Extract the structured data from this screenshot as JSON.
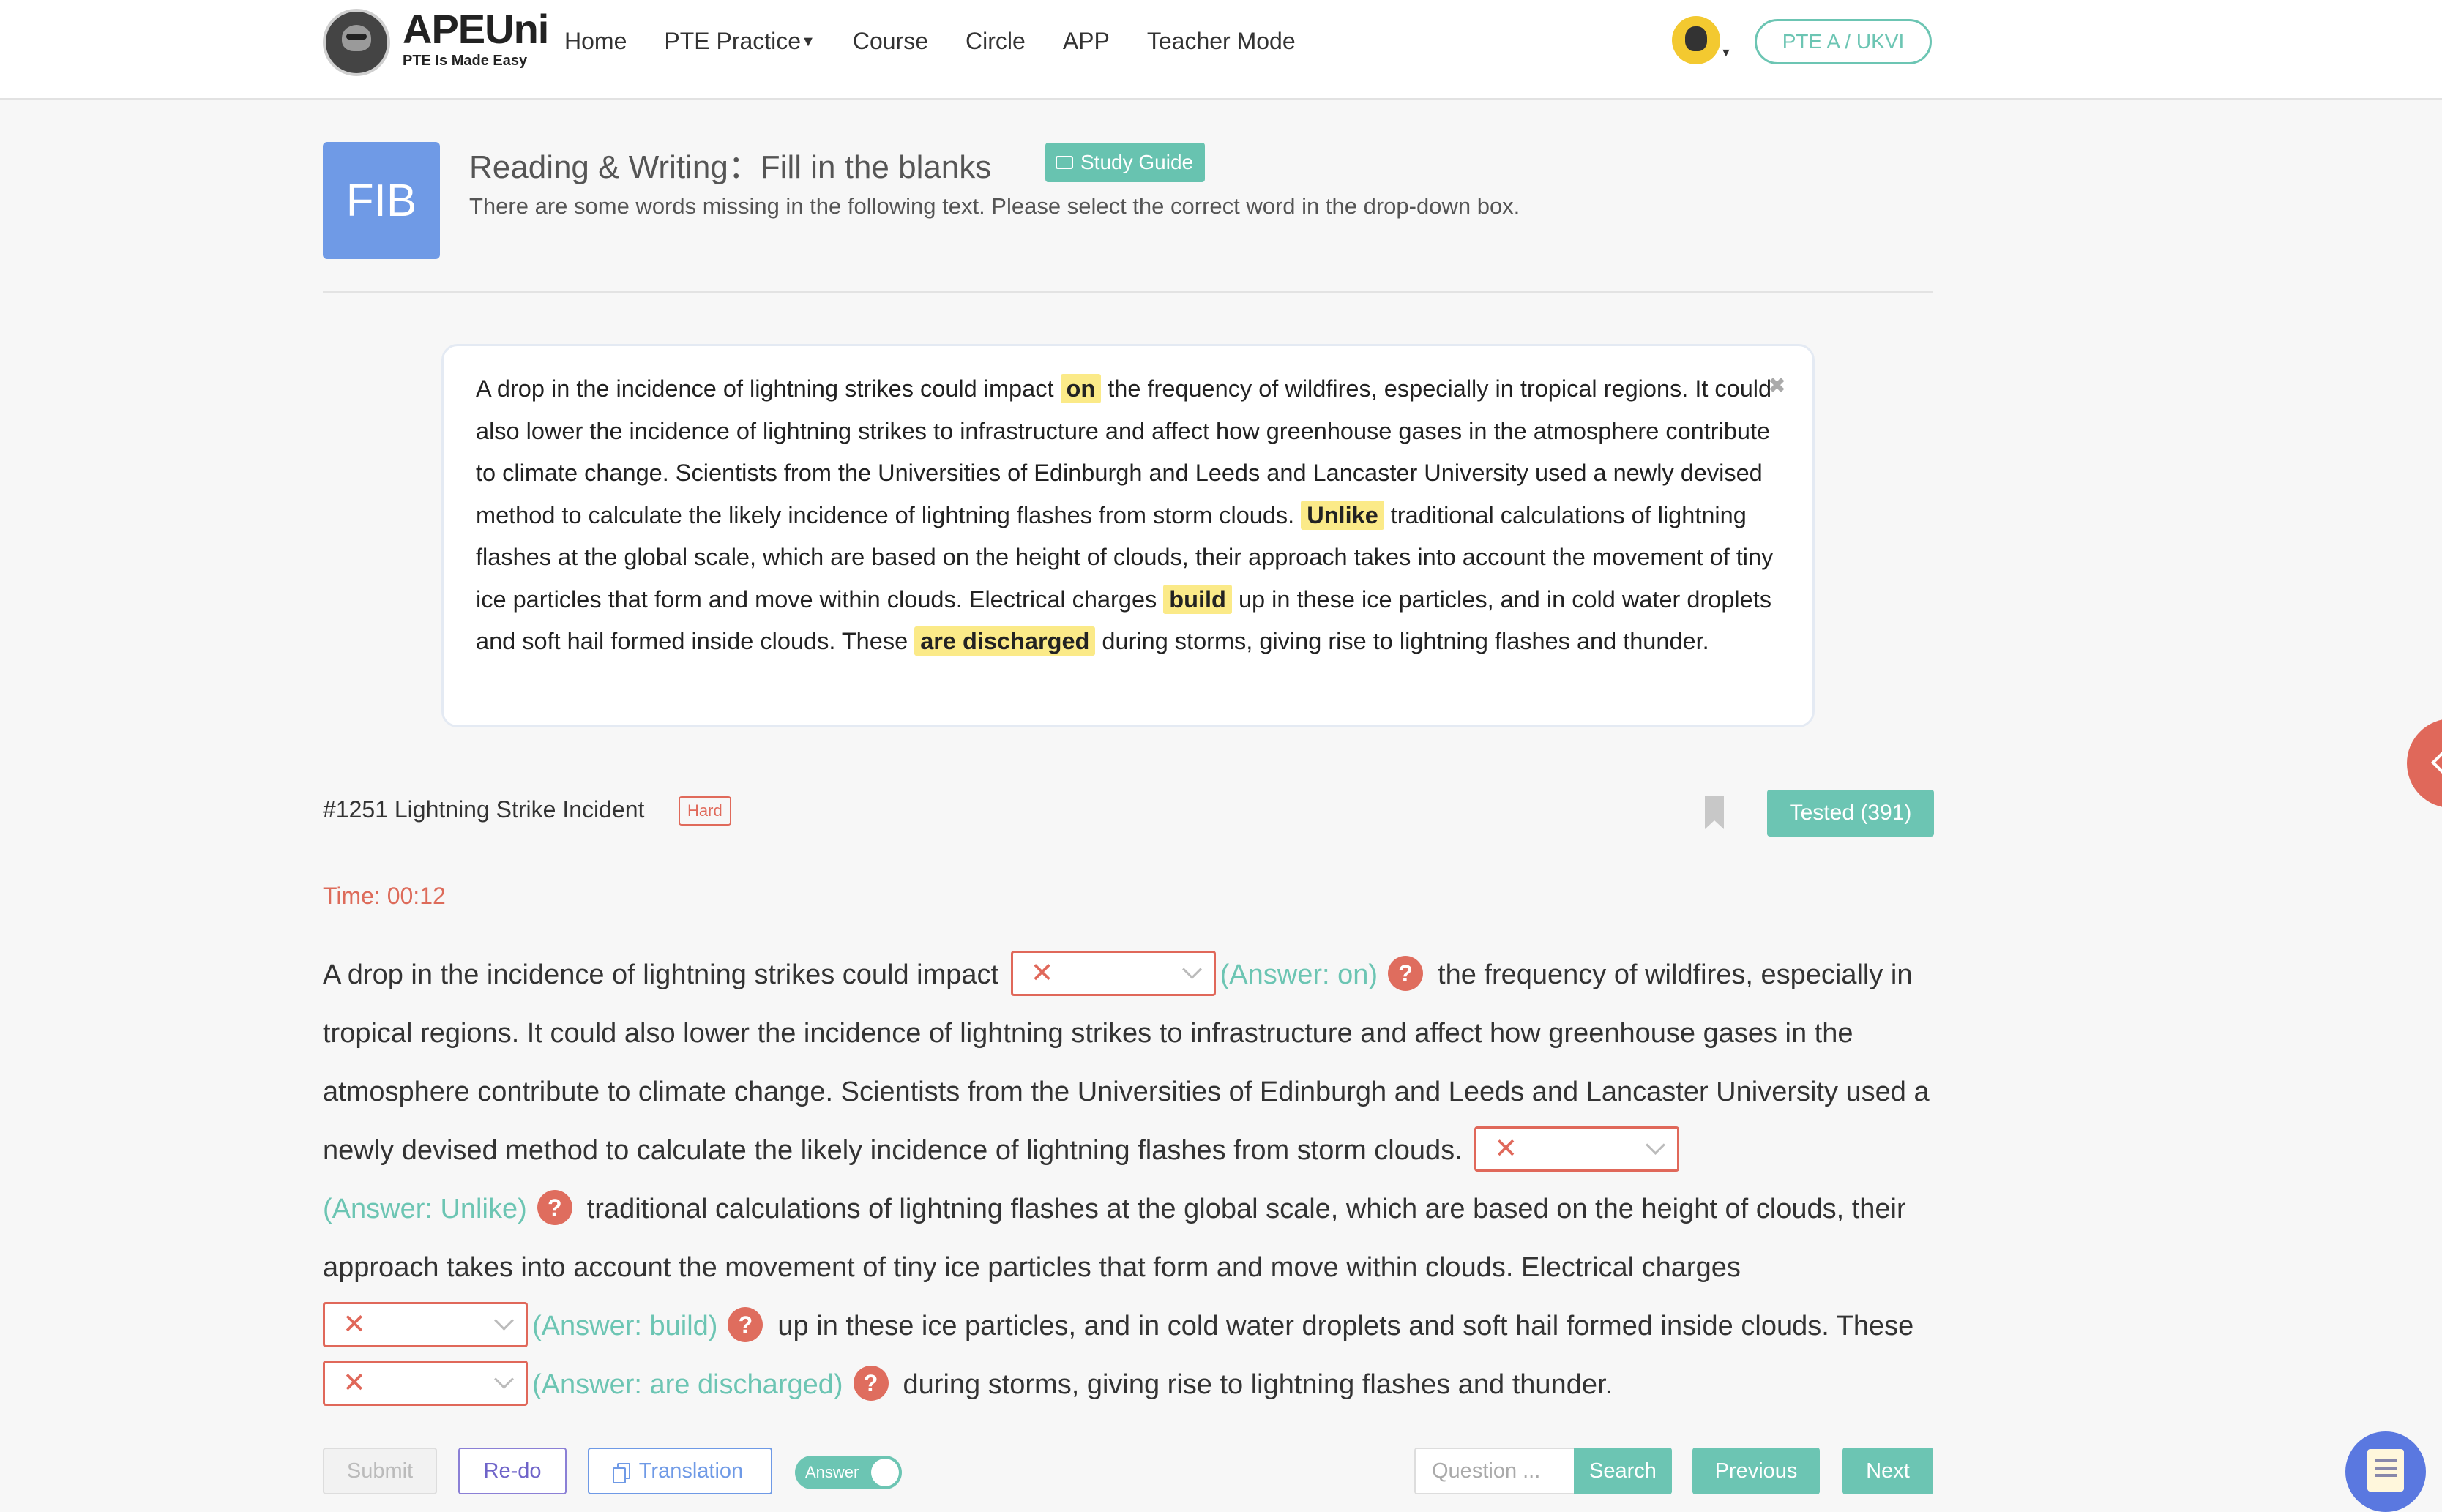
{
  "header": {
    "brand_name": "APEUni",
    "brand_tagline": "PTE Is Made Easy",
    "nav": [
      {
        "label": "Home"
      },
      {
        "label": "PTE Practice",
        "has_dropdown": true
      },
      {
        "label": "Course"
      },
      {
        "label": "Circle"
      },
      {
        "label": "APP"
      },
      {
        "label": "Teacher Mode"
      }
    ],
    "exam_type_button": "PTE A / UKVI"
  },
  "task": {
    "icon_text": "FIB",
    "title": "Reading & Writing：Fill in the blanks",
    "study_guide_label": "Study Guide",
    "description": "There are some words missing in the following text. Please select the correct word in the drop-down box."
  },
  "preview": {
    "segments": [
      {
        "text": "A drop in the incidence of lightning strikes could impact "
      },
      {
        "text": "on",
        "highlight": true
      },
      {
        "text": " the frequency of wildfires, especially in tropical regions. It could also lower the incidence of lightning strikes to infrastructure and affect how greenhouse gases in the atmosphere contribute to climate change. Scientists from the Universities of Edinburgh and Leeds and Lancaster University used a newly devised method to calculate the likely incidence of lightning flashes from storm clouds. "
      },
      {
        "text": "Unlike",
        "highlight": true
      },
      {
        "text": " traditional calculations of lightning flashes at the global scale, which are based on the height of clouds, their approach takes into account the movement of tiny ice particles that form and move within clouds. Electrical charges "
      },
      {
        "text": "build",
        "highlight": true
      },
      {
        "text": " up in these ice particles, and in cold water droplets and soft hail formed inside clouds. These "
      },
      {
        "text": "are discharged",
        "highlight": true
      },
      {
        "text": " during storms, giving rise to lightning flashes and thunder."
      }
    ]
  },
  "question": {
    "id_title": "#1251 Lightning Strike Incident",
    "difficulty": "Hard",
    "tested_label": "Tested (391)",
    "timer": "Time: 00:12"
  },
  "passage": {
    "segments": [
      {
        "text": "A drop in the incidence of lightning strikes could impact "
      },
      {
        "blank": true,
        "mark": "✕",
        "answer": "(Answer: on)"
      },
      {
        "text": "the frequency of wildfires, especially in tropical regions. It could also lower the incidence of lightning strikes to infrastructure and affect how greenhouse gases in the atmosphere contribute to climate change. Scientists from the Universities of Edinburgh and Leeds and Lancaster University used a newly devised method to calculate the likely incidence of lightning flashes from storm clouds. "
      },
      {
        "blank": true,
        "mark": "✕",
        "answer": "(Answer: Unlike)"
      },
      {
        "text": "traditional calculations of lightning flashes at the global scale, which are based on the height of clouds, their approach takes into account the movement of tiny ice particles that form and move within clouds. Electrical charges "
      },
      {
        "blank": true,
        "mark": "✕",
        "answer": "(Answer: build)"
      },
      {
        "text": "up in these ice particles, and in cold water droplets and soft hail formed inside clouds. These "
      },
      {
        "blank": true,
        "mark": "✕",
        "answer": "(Answer: are discharged)"
      },
      {
        "text": "during storms, giving rise to lightning flashes and thunder."
      }
    ]
  },
  "toolbar": {
    "submit_label": "Submit",
    "redo_label": "Re-do",
    "translation_label": "Translation",
    "answer_toggle_label": "Answer",
    "answer_toggle_on": true,
    "search_placeholder": "Question ...",
    "search_label": "Search",
    "previous_label": "Previous",
    "next_label": "Next"
  },
  "colors": {
    "accent_teal": "#6cc5b3",
    "error_red": "#e0685a",
    "fib_blue": "#6f9ae6",
    "highlight_yellow": "#fbea88"
  }
}
